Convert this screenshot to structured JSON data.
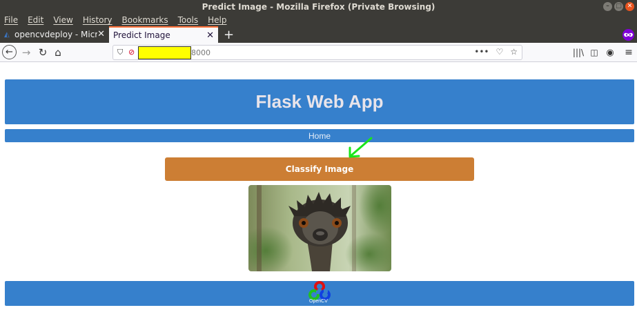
{
  "window": {
    "title": "Predict Image - Mozilla Firefox (Private Browsing)"
  },
  "menu": [
    "File",
    "Edit",
    "View",
    "History",
    "Bookmarks",
    "Tools",
    "Help"
  ],
  "tabs": [
    {
      "label": "opencvdeploy - Microsof",
      "active": false
    },
    {
      "label": "Predict Image",
      "active": true
    }
  ],
  "url": {
    "visible_text": "8000"
  },
  "page": {
    "header_title": "Flask Web App",
    "nav_home": "Home",
    "classify_button": "Classify Image",
    "footer_logo_text": "OpenCV"
  },
  "colors": {
    "header_blue": "#3680cc",
    "classify_orange": "#cc7e34",
    "arrow_green": "#19e619",
    "redaction_yellow": "#ffff00"
  },
  "icons": [
    "back-icon",
    "forward-icon",
    "reload-icon",
    "home-icon",
    "shield-icon",
    "insecure-lock-icon",
    "more-icon",
    "pocket-icon",
    "bookmark-star-icon",
    "library-icon",
    "sidebar-icon",
    "account-icon",
    "menu-icon",
    "private-browsing-icon"
  ]
}
